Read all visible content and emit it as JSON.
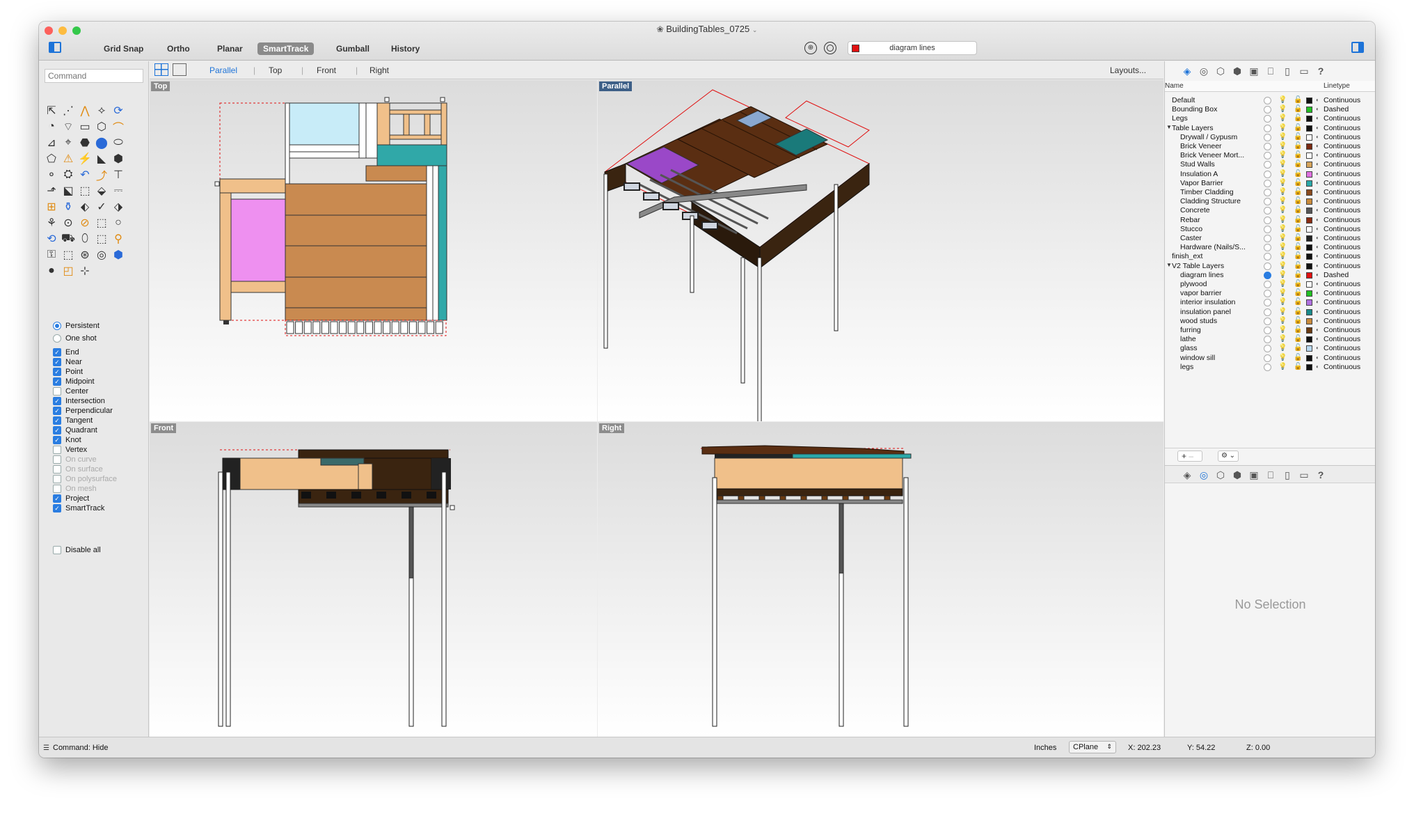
{
  "window": {
    "title": "BuildingTables_0725",
    "toolbar": [
      "Grid Snap",
      "Ortho",
      "Planar",
      "SmartTrack",
      "Gumball",
      "History"
    ],
    "active_toolbar": "SmartTrack",
    "current_layer": "diagram lines",
    "current_layer_color": "#e01010"
  },
  "command": {
    "placeholder": "Command"
  },
  "view_tabs": [
    "Parallel",
    "Top",
    "Front",
    "Right"
  ],
  "active_view_tab": "Parallel",
  "layouts_label": "Layouts...",
  "viewports": {
    "top": "Top",
    "parallel": "Parallel",
    "front": "Front",
    "right": "Right"
  },
  "osnap": {
    "persistent": "Persistent",
    "one_shot": "One shot",
    "items": [
      {
        "label": "End",
        "checked": true
      },
      {
        "label": "Near",
        "checked": true
      },
      {
        "label": "Point",
        "checked": true
      },
      {
        "label": "Midpoint",
        "checked": true
      },
      {
        "label": "Center",
        "checked": false
      },
      {
        "label": "Intersection",
        "checked": true
      },
      {
        "label": "Perpendicular",
        "checked": true
      },
      {
        "label": "Tangent",
        "checked": true
      },
      {
        "label": "Quadrant",
        "checked": true
      },
      {
        "label": "Knot",
        "checked": true
      },
      {
        "label": "Vertex",
        "checked": false
      },
      {
        "label": "On curve",
        "checked": false,
        "disabled": true
      },
      {
        "label": "On surface",
        "checked": false,
        "disabled": true
      },
      {
        "label": "On polysurface",
        "checked": false,
        "disabled": true
      },
      {
        "label": "On mesh",
        "checked": false,
        "disabled": true
      },
      {
        "label": "Project",
        "checked": true
      },
      {
        "label": "SmartTrack",
        "checked": true
      }
    ],
    "disable_all": "Disable all"
  },
  "layers": {
    "header_name": "Name",
    "header_linetype": "Linetype",
    "rows": [
      {
        "name": "Default",
        "indent": 0,
        "color": "#111111",
        "linetype": "Continuous"
      },
      {
        "name": "Bounding Box",
        "indent": 0,
        "color": "#22c022",
        "linetype": "Dashed"
      },
      {
        "name": "Legs",
        "indent": 0,
        "color": "#111111",
        "linetype": "Continuous"
      },
      {
        "name": "Table Layers",
        "indent": 0,
        "expanded": true,
        "color": "#111111",
        "linetype": "Continuous"
      },
      {
        "name": "Drywall / Gypusm",
        "indent": 1,
        "color": "#ffffff",
        "linetype": "Continuous"
      },
      {
        "name": "Brick Veneer",
        "indent": 1,
        "color": "#7a2a12",
        "linetype": "Continuous"
      },
      {
        "name": "Brick Veneer Mort...",
        "indent": 1,
        "color": "#ffffff",
        "linetype": "Continuous"
      },
      {
        "name": "Stud Walls",
        "indent": 1,
        "color": "#d6a45a",
        "linetype": "Continuous"
      },
      {
        "name": "Insulation A",
        "indent": 1,
        "color": "#e070e0",
        "linetype": "Continuous"
      },
      {
        "name": "Vapor Barrier",
        "indent": 1,
        "color": "#2aa8a8",
        "linetype": "Continuous"
      },
      {
        "name": "Timber Cladding",
        "indent": 1,
        "color": "#8a4a1e",
        "linetype": "Continuous"
      },
      {
        "name": "Cladding Structure",
        "indent": 1,
        "color": "#c98a3a",
        "linetype": "Continuous"
      },
      {
        "name": "Concrete",
        "indent": 1,
        "color": "#555555",
        "linetype": "Continuous"
      },
      {
        "name": "Rebar",
        "indent": 1,
        "color": "#8a2a10",
        "linetype": "Continuous"
      },
      {
        "name": "Stucco",
        "indent": 1,
        "color": "#ffffff",
        "linetype": "Continuous"
      },
      {
        "name": "Caster",
        "indent": 1,
        "color": "#222222",
        "linetype": "Continuous"
      },
      {
        "name": "Hardware (Nails/S...",
        "indent": 1,
        "color": "#111111",
        "linetype": "Continuous"
      },
      {
        "name": "finish_ext",
        "indent": 0,
        "color": "#111111",
        "linetype": "Continuous"
      },
      {
        "name": "V2 Table Layers",
        "indent": 0,
        "expanded": true,
        "color": "#111111",
        "linetype": "Continuous"
      },
      {
        "name": "diagram lines",
        "indent": 1,
        "current": true,
        "color": "#e01010",
        "linetype": "Dashed"
      },
      {
        "name": "plywood",
        "indent": 1,
        "color": "#ffffff",
        "linetype": "Continuous"
      },
      {
        "name": "vapor barrier",
        "indent": 1,
        "color": "#22c022",
        "linetype": "Continuous"
      },
      {
        "name": "interior insulation",
        "indent": 1,
        "color": "#b070e0",
        "linetype": "Continuous"
      },
      {
        "name": "insulation panel",
        "indent": 1,
        "color": "#1a8a8a",
        "linetype": "Continuous"
      },
      {
        "name": "wood studs",
        "indent": 1,
        "color": "#c98a3a",
        "linetype": "Continuous"
      },
      {
        "name": "furring",
        "indent": 1,
        "color": "#6a3a10",
        "linetype": "Continuous"
      },
      {
        "name": "lathe",
        "indent": 1,
        "color": "#111111",
        "linetype": "Continuous"
      },
      {
        "name": "glass",
        "indent": 1,
        "color": "#b8d8f0",
        "linetype": "Continuous"
      },
      {
        "name": "window sill",
        "indent": 1,
        "color": "#111111",
        "linetype": "Continuous"
      },
      {
        "name": "legs",
        "indent": 1,
        "color": "#111111",
        "linetype": "Continuous"
      }
    ]
  },
  "properties": {
    "empty_text": "No Selection"
  },
  "status": {
    "command": "Command: Hide",
    "units": "Inches",
    "cplane": "CPlane",
    "x": "X: 202.23",
    "y": "Y: 54.22",
    "z": "Z: 0.00"
  }
}
